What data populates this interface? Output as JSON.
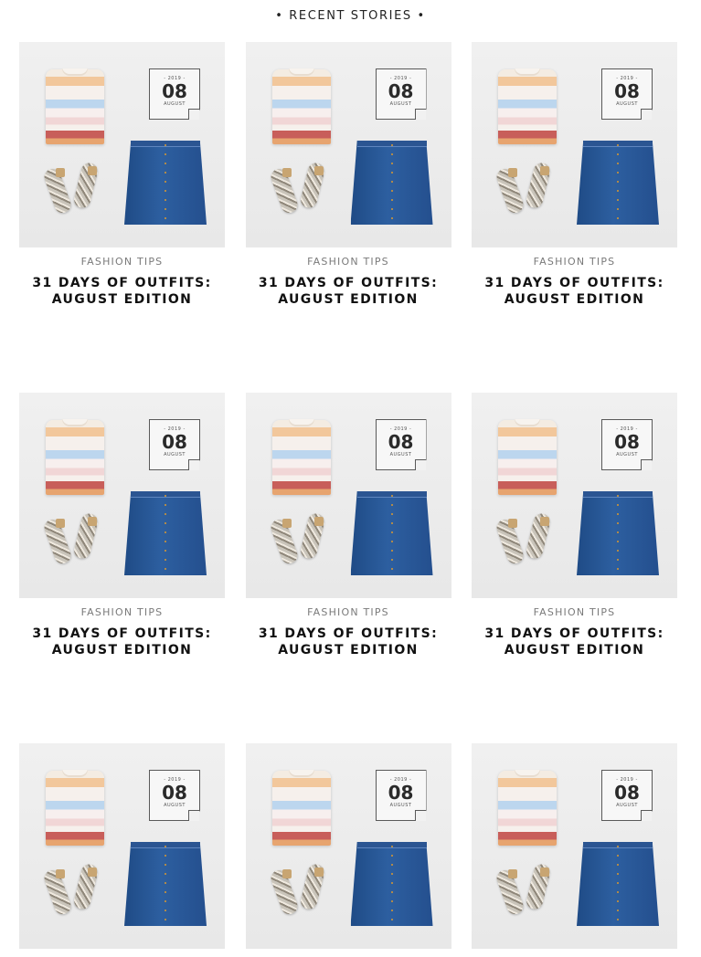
{
  "section": {
    "heading": "• RECENT STORIES •"
  },
  "posts": [
    {
      "category": "FASHION TIPS",
      "title": "31 DAYS OF OUTFITS: AUGUST EDITION",
      "badge": {
        "year": "- 2019 -",
        "day": "08",
        "month": "AUGUST"
      }
    },
    {
      "category": "FASHION TIPS",
      "title": "31 DAYS OF OUTFITS: AUGUST EDITION",
      "badge": {
        "year": "- 2019 -",
        "day": "08",
        "month": "AUGUST"
      }
    },
    {
      "category": "FASHION TIPS",
      "title": "31 DAYS OF OUTFITS: AUGUST EDITION",
      "badge": {
        "year": "- 2019 -",
        "day": "08",
        "month": "AUGUST"
      }
    },
    {
      "category": "FASHION TIPS",
      "title": "31 DAYS OF OUTFITS: AUGUST EDITION",
      "badge": {
        "year": "- 2019 -",
        "day": "08",
        "month": "AUGUST"
      }
    },
    {
      "category": "FASHION TIPS",
      "title": "31 DAYS OF OUTFITS: AUGUST EDITION",
      "badge": {
        "year": "- 2019 -",
        "day": "08",
        "month": "AUGUST"
      }
    },
    {
      "category": "FASHION TIPS",
      "title": "31 DAYS OF OUTFITS: AUGUST EDITION",
      "badge": {
        "year": "- 2019 -",
        "day": "08",
        "month": "AUGUST"
      }
    },
    {
      "category": "",
      "title": "",
      "badge": {
        "year": "- 2019 -",
        "day": "08",
        "month": "AUGUST"
      }
    },
    {
      "category": "",
      "title": "",
      "badge": {
        "year": "- 2019 -",
        "day": "08",
        "month": "AUGUST"
      }
    },
    {
      "category": "",
      "title": "",
      "badge": {
        "year": "- 2019 -",
        "day": "08",
        "month": "AUGUST"
      }
    }
  ]
}
